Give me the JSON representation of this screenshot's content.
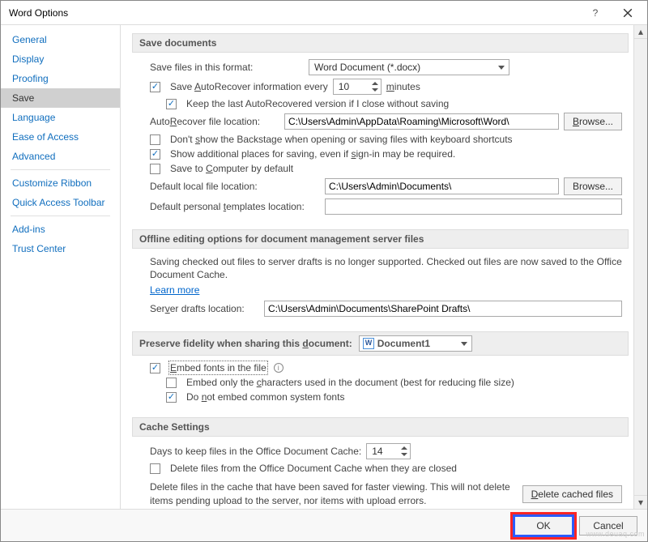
{
  "window": {
    "title": "Word Options"
  },
  "sidebar": {
    "items": [
      "General",
      "Display",
      "Proofing",
      "Save",
      "Language",
      "Ease of Access",
      "Advanced"
    ],
    "items2": [
      "Customize Ribbon",
      "Quick Access Toolbar"
    ],
    "items3": [
      "Add-ins",
      "Trust Center"
    ],
    "selected": "Save"
  },
  "save_documents": {
    "header": "Save documents",
    "format_label": "Save files in this format:",
    "format_value": "Word Document (*.docx)",
    "autorecover_label_pre": "Save ",
    "autorecover_label_mid": "utoRecover information every",
    "autorecover_minutes": "10",
    "minutes_label": "minutes",
    "keep_last_label": "Keep the last AutoRecovered version if I close without saving",
    "autorecover_loc_label_pre": "Auto",
    "autorecover_loc_label_post": "ecover file location:",
    "autorecover_loc_value": "C:\\Users\\Admin\\AppData\\Roaming\\Microsoft\\Word\\",
    "browse": "Browse...",
    "backstage_label_pre": "Don't ",
    "backstage_label_post": "how the Backstage when opening or saving files with keyboard shortcuts",
    "additional_places_label_pre": "Show additional places for saving, even if ",
    "additional_places_label_post": "ign-in may be required.",
    "save_computer_label_pre": "Save to ",
    "save_computer_label_post": "omputer by default",
    "default_local_label_pre": "Default local file location:",
    "default_local_value": "C:\\Users\\Admin\\Documents\\",
    "default_templates_label_pre": "Default personal ",
    "default_templates_label_post": "emplates location:"
  },
  "offline": {
    "header": "Offline editing options for document management server files",
    "note": "Saving checked out files to server drafts is no longer supported. Checked out files are now saved to the Office Document Cache.",
    "learn_more": "Learn more",
    "drafts_label_pre": "Ser",
    "drafts_label_post": "er drafts location:",
    "drafts_value": "C:\\Users\\Admin\\Documents\\SharePoint Drafts\\"
  },
  "preserve": {
    "header_pre": "Preserve fidelity when sharing this ",
    "header_post": "ocument:",
    "doc_name": "Document1",
    "embed_label_pre": "Embed fonts in the file",
    "embed_only_pre": "Embed only the ",
    "embed_only_post": "haracters used in the document (best for reducing file size)",
    "no_common_pre": "Do ",
    "no_common_post": "ot embed common system fonts"
  },
  "cache": {
    "header": "Cache Settings",
    "days_label": "Days to keep files in the Office Document Cache:",
    "days_value": "14",
    "delete_closed_label": "Delete files from the Office Document Cache when they are closed",
    "note": "Delete files in the cache that have been saved for faster viewing. This will not delete items pending upload to the server, nor items with upload errors.",
    "delete_btn_pre": "Delete cached files"
  },
  "footer": {
    "ok": "OK",
    "cancel": "Cancel"
  },
  "watermark": "www.deuaq.com"
}
